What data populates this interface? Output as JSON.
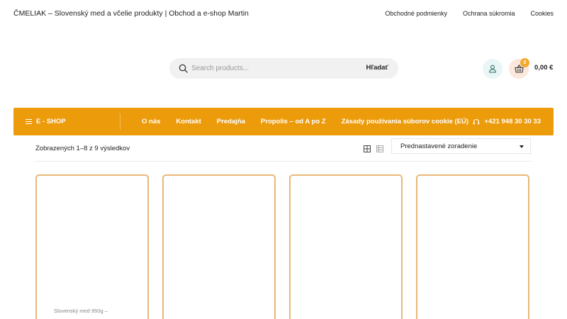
{
  "header": {
    "site_title": "ČMELIAK – Slovenský med a včelie produkty | Obchod a e-shop Martin",
    "links": [
      "Obchodné podmienky",
      "Ochrana súkromia",
      "Cookies"
    ]
  },
  "search": {
    "placeholder": "Search products...",
    "value": "",
    "button_label": "Hľadať",
    "icon": "search-icon"
  },
  "account": {
    "icon": "user-icon"
  },
  "cart": {
    "icon": "basket-icon",
    "count": "0",
    "total": "0,00 €"
  },
  "nav": {
    "eshop_label": "E - SHOP",
    "items": [
      "O nás",
      "Kontakt",
      "Predajňa",
      "Propolis – od A po Z",
      "Zásady používania súborov cookie (EÚ)"
    ],
    "phone": "+421 948 30 30 33",
    "phone_icon": "headset-icon"
  },
  "shop": {
    "results_text": "Zobrazených 1–8 z 9 výsledkov",
    "view_modes": [
      "grid-view-icon",
      "list-view-icon"
    ],
    "sort_selected": "Prednastavené zoradenie"
  },
  "products": [
    {
      "name": "Slovenský med 950g –"
    },
    {
      "name": ""
    },
    {
      "name": ""
    },
    {
      "name": ""
    }
  ],
  "colors": {
    "accent": "#ec9b0b",
    "card_border": "#e8b878",
    "badge": "#f2a92c"
  }
}
